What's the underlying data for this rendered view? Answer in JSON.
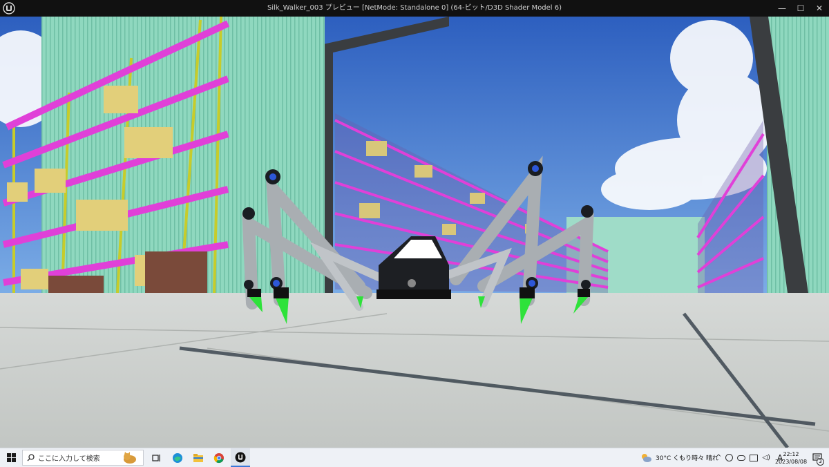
{
  "window": {
    "title": "Silk_Walker_003 プレビュー [NetMode: Standalone 0]  (64-ビット/D3D Shader Model 6)",
    "minimize_glyph": "—",
    "maximize_glyph": "☐",
    "close_glyph": "✕",
    "logo_icon": "unreal-engine-logo-icon"
  },
  "viewport": {
    "scene": "3d-game-preview",
    "colors": {
      "sky": "#3f6fc6",
      "wall": "#8fd8bf",
      "rack": "#e040d8",
      "floor": "#cfd3d0",
      "leg_tip": "#2ee23a"
    }
  },
  "taskbar": {
    "search_placeholder": "ここに入力して検索",
    "weather": "30°C  くもり時々 晴れ",
    "ime_label": "A",
    "time": "22:12",
    "date": "2023/08/08",
    "notification_count": "3"
  }
}
